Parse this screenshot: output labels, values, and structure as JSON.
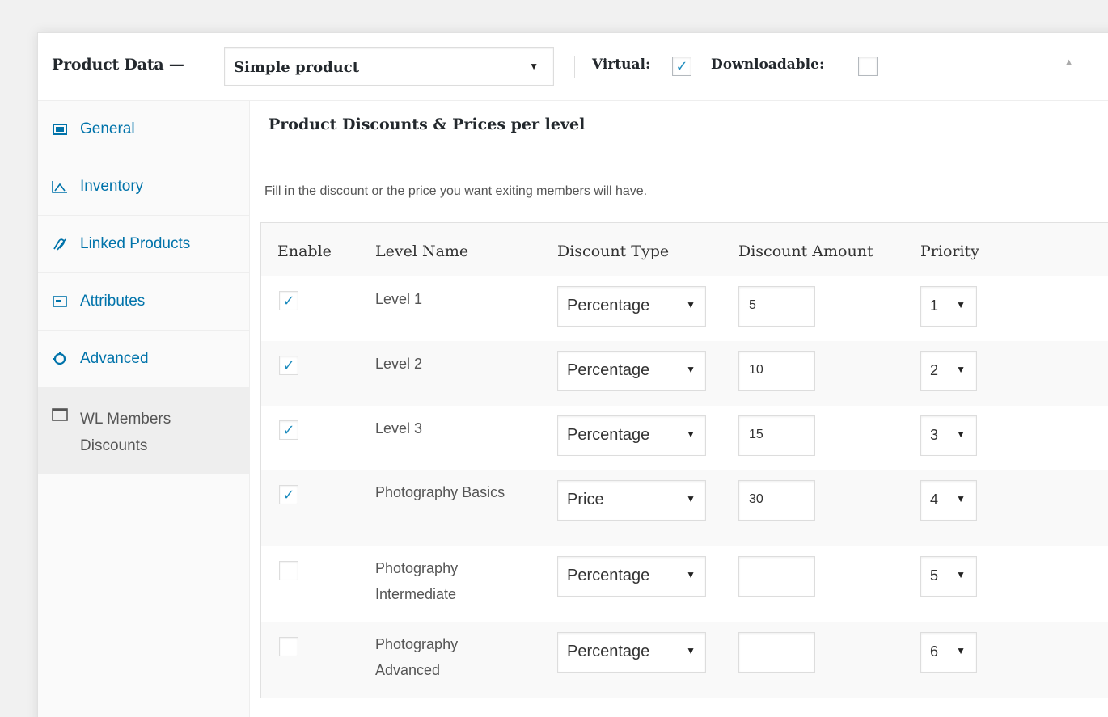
{
  "header": {
    "title": "Product Data —",
    "product_type": "Simple product",
    "virtual_label": "Virtual:",
    "virtual_checked": true,
    "downloadable_label": "Downloadable:",
    "downloadable_checked": false,
    "collapse_icon": "triangle-up-icon"
  },
  "sidebar": {
    "items": [
      {
        "label": "General",
        "icon": "general-icon"
      },
      {
        "label": "Inventory",
        "icon": "inventory-icon"
      },
      {
        "label": "Linked Products",
        "icon": "link-icon"
      },
      {
        "label": "Attributes",
        "icon": "attributes-icon"
      },
      {
        "label": "Advanced",
        "icon": "gear-icon"
      },
      {
        "label": "WL Members Discounts",
        "icon": "window-icon",
        "active": true
      }
    ]
  },
  "main": {
    "title": "Product Discounts & Prices per level",
    "description": "Fill in the discount or the price you want exiting members will have.",
    "columns": [
      "Enable",
      "Level Name",
      "Discount Type",
      "Discount Amount",
      "Priority"
    ],
    "rows": [
      {
        "enabled": true,
        "level": "Level 1",
        "type": "Percentage",
        "amount": "5",
        "priority": "1"
      },
      {
        "enabled": true,
        "level": "Level 2",
        "type": "Percentage",
        "amount": "10",
        "priority": "2"
      },
      {
        "enabled": true,
        "level": "Level 3",
        "type": "Percentage",
        "amount": "15",
        "priority": "3"
      },
      {
        "enabled": true,
        "level": "Photography Basics",
        "type": "Price",
        "amount": "30",
        "priority": "4"
      },
      {
        "enabled": false,
        "level": "Photography Intermediate",
        "type": "Percentage",
        "amount": "",
        "priority": "5"
      },
      {
        "enabled": false,
        "level": "Photography Advanced",
        "type": "Percentage",
        "amount": "",
        "priority": "6"
      }
    ]
  },
  "colors": {
    "accent": "#0073aa",
    "check": "#1e8cbe",
    "text": "#23282d"
  }
}
